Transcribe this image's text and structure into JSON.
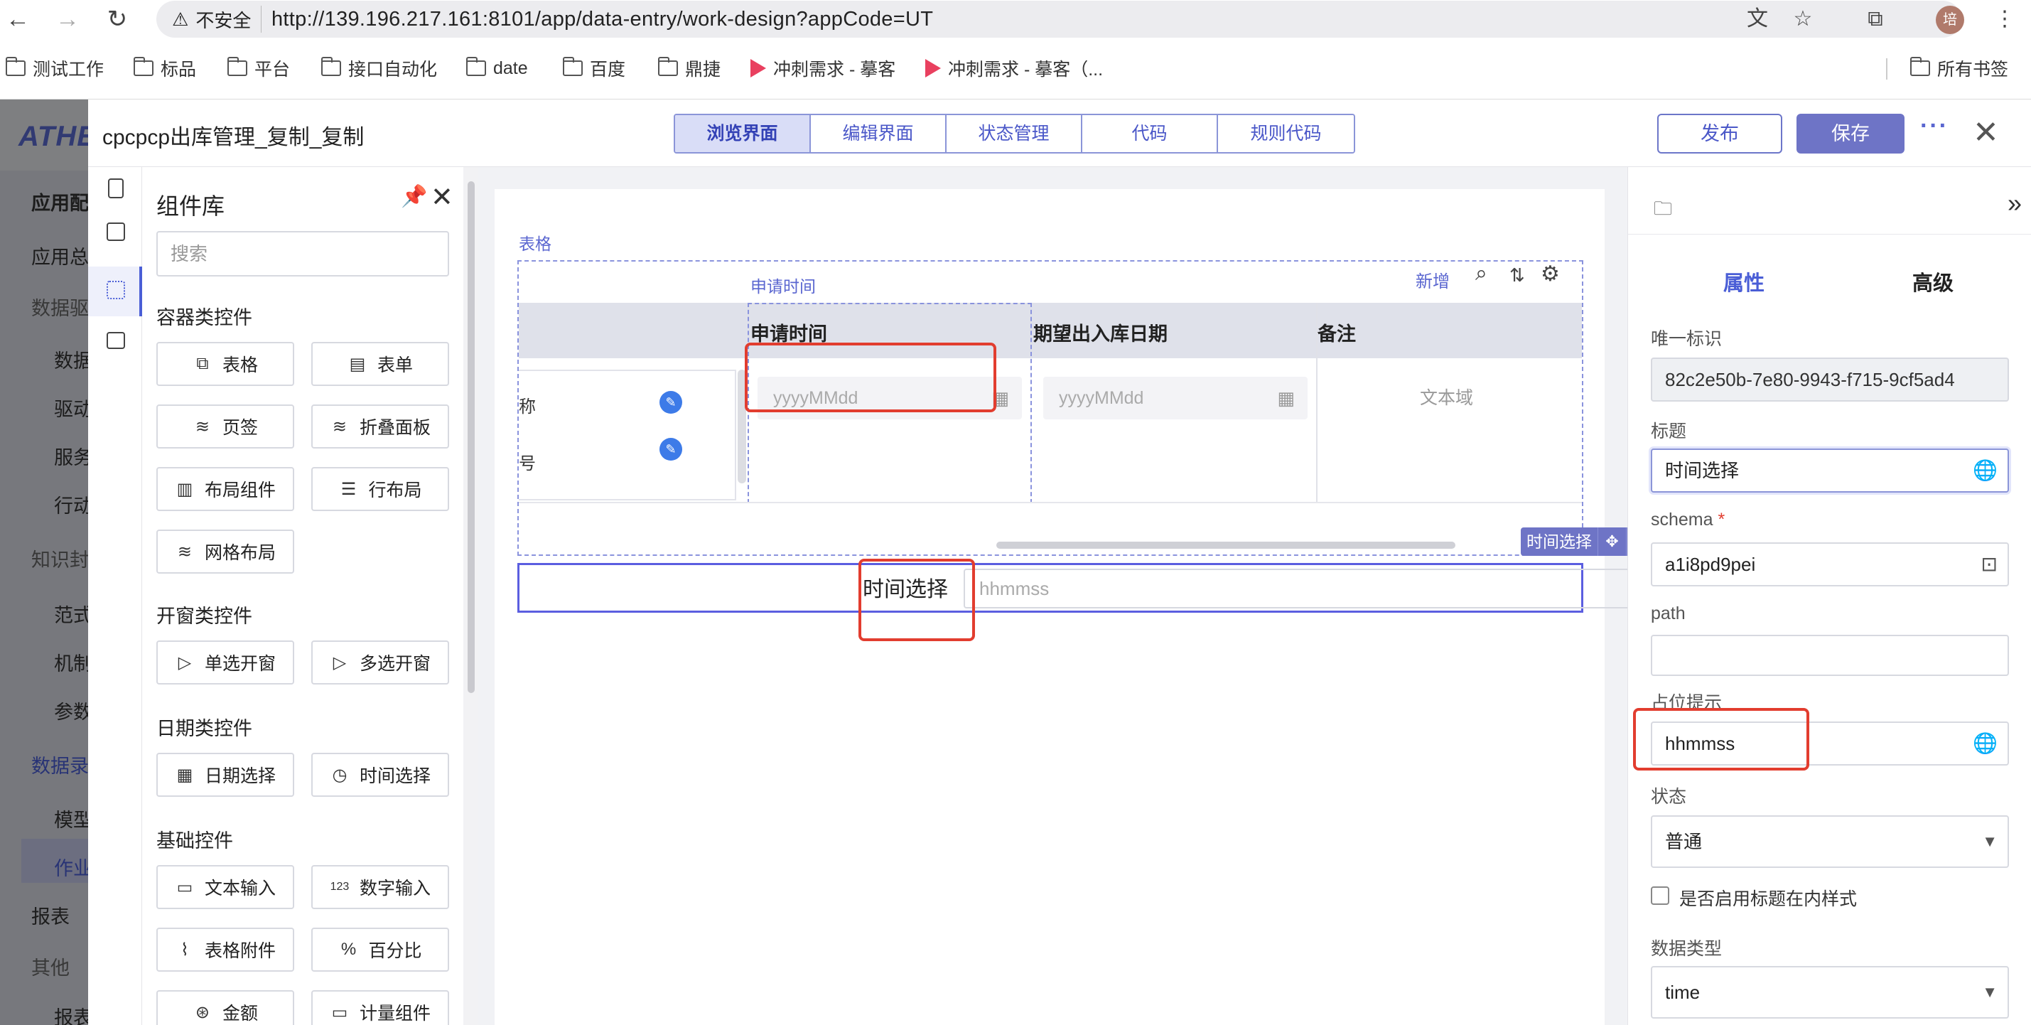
{
  "browser": {
    "url": "http://139.196.217.161:8101/app/data-entry/work-design?appCode=UT",
    "insecure_label": "不安全",
    "profile_initial": "培",
    "bookmarks": [
      "测试工作",
      "标品",
      "平台",
      "接口自动化",
      "date",
      "百度",
      "鼎捷",
      "冲刺需求 - 摹客",
      "冲刺需求 - 摹客（..."
    ],
    "all_bookmarks": "所有书签"
  },
  "background_app": {
    "logo": "ATHENA",
    "items": [
      "应用配",
      "应用总",
      "数据驱",
      "数据",
      "驱动",
      "服务",
      "行动",
      "知识封",
      "范式",
      "机制",
      "参数",
      "数据录",
      "模型",
      "作业",
      "报表",
      "其他",
      "报表"
    ]
  },
  "dialog": {
    "title": "cpcpcp出库管理_复制_复制",
    "tabs": [
      "浏览界面",
      "编辑界面",
      "状态管理",
      "代码",
      "规则代码"
    ],
    "publish_label": "发布",
    "save_label": "保存",
    "more_label": "···",
    "close_label": "✕"
  },
  "component_library": {
    "title": "组件库",
    "search_placeholder": "搜索",
    "sections": {
      "container": "容器类控件",
      "window": "开窗类控件",
      "date": "日期类控件",
      "basic": "基础控件"
    },
    "container_items": [
      "表格",
      "表单",
      "页签",
      "折叠面板",
      "布局组件",
      "行布局",
      "网格布局"
    ],
    "window_items": [
      "单选开窗",
      "多选开窗"
    ],
    "date_items": [
      "日期选择",
      "时间选择"
    ],
    "basic_items": [
      "文本输入",
      "数字输入",
      "表格附件",
      "百分比",
      "金额",
      "计量组件"
    ]
  },
  "canvas": {
    "table_label": "表格",
    "column_label": "申请时间",
    "add_link": "新增",
    "headers": [
      "申请时间",
      "期望出入库日期",
      "备注"
    ],
    "sub_rows": [
      "称",
      "号"
    ],
    "date_placeholder_1": "yyyyMMdd",
    "date_placeholder_2": "yyyyMMdd",
    "textarea_placeholder": "文本域",
    "selected_badge": "时间选择",
    "time_label": "时间选择",
    "time_placeholder": "hhmmss"
  },
  "properties": {
    "tab_properties": "属性",
    "tab_advanced": "高级",
    "uid_label": "唯一标识",
    "uid_value": "82c2e50b-7e80-9943-f715-9cf5ad4",
    "title_label": "标题",
    "title_value": "时间选择",
    "schema_label": "schema",
    "schema_value": "a1i8pd9pei",
    "path_label": "path",
    "path_value": "",
    "placeholder_label": "占位提示",
    "placeholder_value": "hhmmss",
    "status_label": "状态",
    "status_value": "普通",
    "inline_title_label": "是否启用标题在内样式",
    "datatype_label": "数据类型",
    "datatype_value": "time"
  },
  "colors": {
    "accent": "#4a5ed6",
    "save_button": "#6e74c6",
    "highlight_red": "#e23d2f",
    "selection_border": "#5b5ee0"
  }
}
